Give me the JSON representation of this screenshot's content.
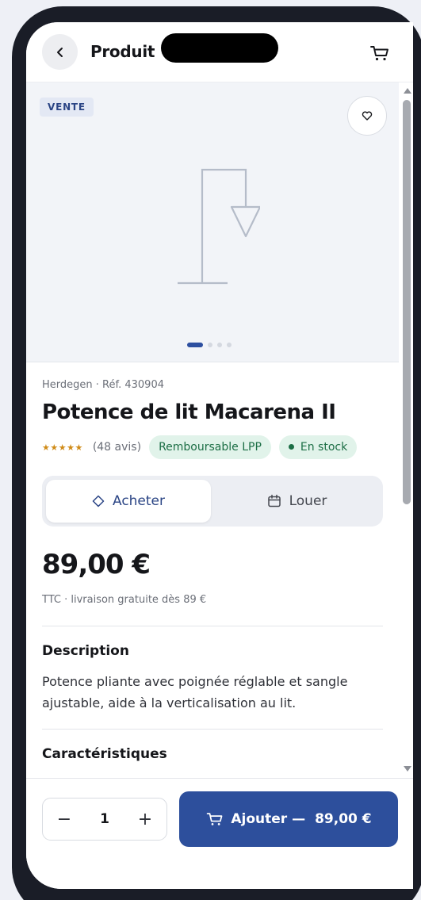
{
  "header": {
    "title": "Produit",
    "back_icon": "chevron-left-icon",
    "cart_icon": "cart-icon"
  },
  "gallery": {
    "badge": "VENTE",
    "favorite_icon": "heart-icon",
    "illustration_icon": "bed-trapeze-icon",
    "image_count": 4,
    "active_image": 1
  },
  "product": {
    "meta": "Herdegen · Réf. 430904",
    "title": "Potence de lit Macarena II",
    "stars": "★★★★★",
    "reviews": "(48 avis)",
    "reimbursable": "Remboursable LPP",
    "stock": "En stock"
  },
  "mode": {
    "buy_label": "Acheter",
    "rent_label": "Louer",
    "selected": "Acheter"
  },
  "price": {
    "amount": "89,00 €",
    "note": "TTC · livraison gratuite dès 89 €"
  },
  "description": {
    "title": "Description",
    "text": "Potence pliante avec poignée réglable et sangle ajustable, aide à la verticalisation au lit."
  },
  "characteristics": {
    "title": "Caractéristiques"
  },
  "cart_bar": {
    "minus": "−",
    "quantity": "1",
    "plus": "+",
    "add_label": "Ajouter —",
    "add_price": "89,00  €"
  },
  "colors": {
    "primary": "#2d4f9c",
    "stock_green": "#1c6e45",
    "stars": "#d08b18"
  }
}
